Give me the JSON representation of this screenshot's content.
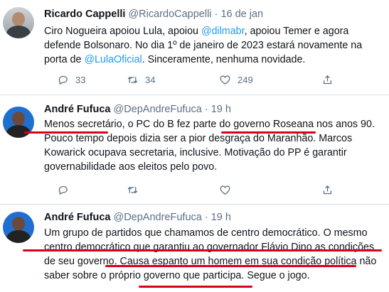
{
  "tweets": [
    {
      "name": "Ricardo Cappelli",
      "handle": "@RicardoCappelli",
      "sep": "·",
      "date": "16 de jan",
      "text": {
        "p1": "Ciro Nogueira apoiou Lula, apoiou ",
        "m1": "@dilmabr",
        "p2": ", apoiou Temer e agora defende Bolsonaro. No dia 1º de janeiro de 2023 estará novamente na porta de ",
        "m2": "@LulaOficial",
        "p3": ". Sinceramente, nenhuma novidade."
      },
      "replies": "33",
      "retweets": "34",
      "likes": "249"
    },
    {
      "name": "André Fufuca",
      "handle": "@DepAndreFufuca",
      "sep": "·",
      "date": "19 h",
      "text": "Menos secretário, o PC do B fez parte do governo Roseana nos anos 90. Pouco tempo depois dizia ser a pior desgraça do Maranhão. Marcos Kowarick ocupava secretaria, inclusive. Motivação do PP é garantir governabilidade aos eleitos pelo povo."
    },
    {
      "name": "André Fufuca",
      "handle": "@DepAndreFufuca",
      "sep": "·",
      "date": "19 h",
      "text": "Um grupo de partidos que chamamos de centro democrático. O mesmo centro democrático que garantiu ao governador Flávio Dino as condições de seu governo. Causa espanto um homem em sua condição política não saber sobre o próprio governo que participa. Segue o jogo."
    }
  ],
  "icons": [
    "reply-icon",
    "retweet-icon",
    "like-icon",
    "share-icon"
  ],
  "colors": {
    "mention": "#1d9bf0",
    "underline": "#d9001b",
    "meta": "#5b7083"
  }
}
